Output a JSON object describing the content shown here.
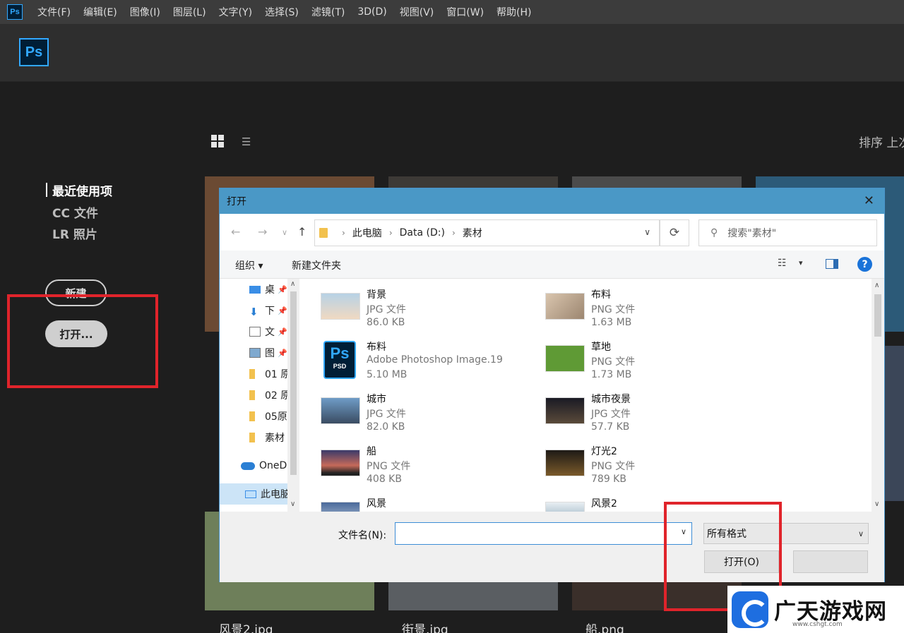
{
  "menu": {
    "app_icon": "Ps",
    "items": [
      "文件(F)",
      "编辑(E)",
      "图像(I)",
      "图层(L)",
      "文字(Y)",
      "选择(S)",
      "滤镜(T)",
      "3D(D)",
      "视图(V)",
      "窗口(W)",
      "帮助(H)"
    ]
  },
  "header": {
    "logo": "Ps"
  },
  "left_nav": {
    "recent": "最近使用项",
    "cc": "CC 文件",
    "lr": "LR 照片",
    "new_button": "新建",
    "open_button": "打开..."
  },
  "view": {
    "sort_label": "排序  上次"
  },
  "background_files": [
    "风景2.jpg",
    "街景.jpg",
    "船.png"
  ],
  "dialog": {
    "title": "打开",
    "close": "✕",
    "breadcrumb": [
      "此电脑",
      "Data (D:)",
      "素材"
    ],
    "search_placeholder": "搜索\"素材\"",
    "organize": "组织 ▾",
    "new_folder": "新建文件夹",
    "help": "?",
    "nav_items": [
      {
        "label": "桌",
        "icon": "desktop-icon",
        "pinned": true
      },
      {
        "label": "下",
        "icon": "download-icon",
        "pinned": true
      },
      {
        "label": "文",
        "icon": "document-icon",
        "pinned": true
      },
      {
        "label": "图",
        "icon": "picture-icon",
        "pinned": true
      },
      {
        "label": "01 原",
        "icon": "folder-icon",
        "pinned": false
      },
      {
        "label": "02 原",
        "icon": "folder-icon",
        "pinned": false
      },
      {
        "label": "05原",
        "icon": "folder-icon",
        "pinned": false
      },
      {
        "label": "素材",
        "icon": "folder-icon",
        "pinned": false
      },
      {
        "label": "OneD",
        "icon": "onedrive-icon",
        "pinned": false
      },
      {
        "label": "此电脑",
        "icon": "computer-icon",
        "pinned": false
      }
    ],
    "files": [
      {
        "name": "背景",
        "type": "JPG 文件",
        "size": "86.0 KB",
        "thumb_color": "#8fb3c9"
      },
      {
        "name": "布料",
        "type": "PNG 文件",
        "size": "1.63 MB",
        "thumb_color": "#c2ad96"
      },
      {
        "name": "布料",
        "type": "Adobe Photoshop Image.19",
        "size": "5.10 MB",
        "thumb_color": "psd"
      },
      {
        "name": "草地",
        "type": "PNG 文件",
        "size": "1.73 MB",
        "thumb_color": "#5f9a35"
      },
      {
        "name": "城市",
        "type": "JPG 文件",
        "size": "82.0 KB",
        "thumb_color": "#5d83a8"
      },
      {
        "name": "城市夜景",
        "type": "JPG 文件",
        "size": "57.7 KB",
        "thumb_color": "#2b2a35"
      },
      {
        "name": "船",
        "type": "PNG 文件",
        "size": "408 KB",
        "thumb_color": "#6e4f6a"
      },
      {
        "name": "灯光2",
        "type": "PNG 文件",
        "size": "789 KB",
        "thumb_color": "#4a3a24"
      },
      {
        "name": "风景",
        "type": "",
        "size": "",
        "thumb_color": "#7f97b3"
      },
      {
        "name": "风景2",
        "type": "",
        "size": "",
        "thumb_color": "#a7c0cf"
      }
    ],
    "filename_label": "文件名(N):",
    "filename_value": "",
    "filter": "所有格式",
    "open_button": "打开(O)",
    "cancel_button": ""
  },
  "watermark": {
    "text": "广天游戏网",
    "url": "www.cshgt.com"
  }
}
